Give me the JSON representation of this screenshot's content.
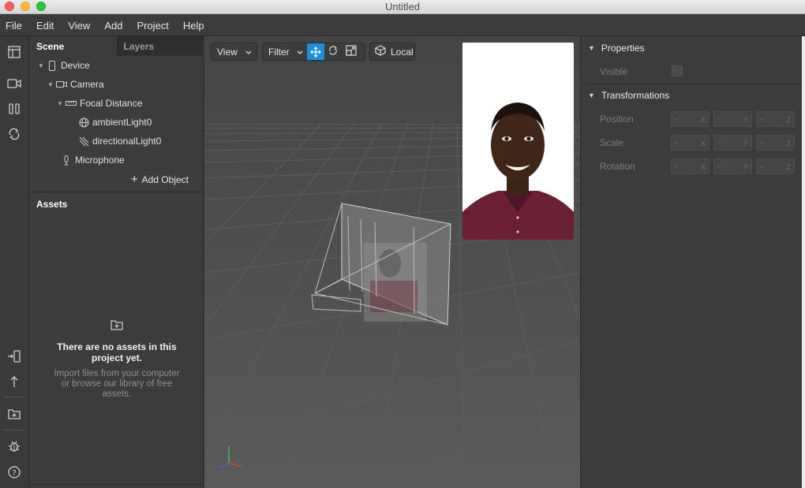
{
  "window": {
    "title": "Untitled"
  },
  "menu": [
    "File",
    "Edit",
    "View",
    "Add",
    "Project",
    "Help"
  ],
  "left_toolbar": [
    "layout-icon",
    "camera-icon",
    "pause-columns-icon",
    "sync-icon",
    "send-to-device-icon",
    "upload-icon",
    "add-folder-icon",
    "bug-icon",
    "help-icon"
  ],
  "scene": {
    "tabs": [
      "Scene",
      "Layers"
    ],
    "tree": [
      {
        "label": "Device",
        "icon": "phone-icon"
      },
      {
        "label": "Camera",
        "icon": "camera-icon"
      },
      {
        "label": "Focal Distance",
        "icon": "ruler-icon"
      },
      {
        "label": "ambientLight0",
        "icon": "globe-icon"
      },
      {
        "label": "directionalLight0",
        "icon": "directional-light-icon"
      },
      {
        "label": "Microphone",
        "icon": "microphone-icon"
      }
    ],
    "add_object_label": "Add Object"
  },
  "assets": {
    "title": "Assets",
    "empty_title": "There are no assets in this project yet.",
    "empty_desc": "Import files from your computer or browse our library of free assets."
  },
  "viewport": {
    "view_label": "View",
    "filter_label": "Filter",
    "local_label": "Local",
    "accent": "#1e8fe0"
  },
  "properties": {
    "title": "Properties",
    "visible_label": "Visible",
    "transform_title": "Transformations",
    "rows": [
      {
        "label": "Position",
        "axes": [
          "X",
          "Y",
          "Z"
        ]
      },
      {
        "label": "Scale",
        "axes": [
          "X",
          "Y",
          "Z"
        ]
      },
      {
        "label": "Rotation",
        "axes": [
          "X",
          "Y",
          "Z"
        ]
      }
    ],
    "placeholder": "–"
  }
}
